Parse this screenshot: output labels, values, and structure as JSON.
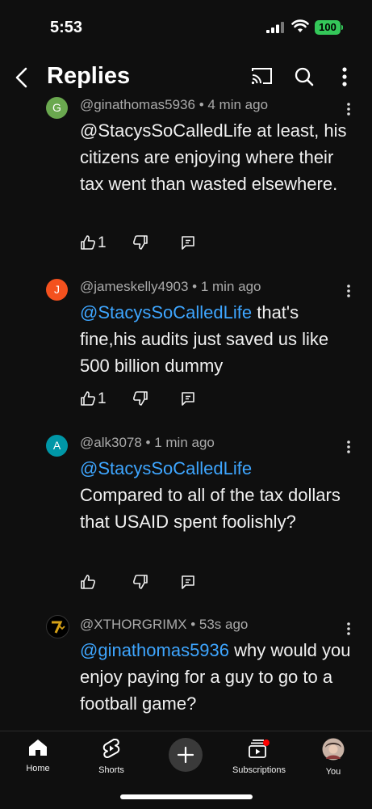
{
  "status_bar": {
    "time": "5:53",
    "battery": "100"
  },
  "header": {
    "title": "Replies"
  },
  "comments": [
    {
      "avatar_letter": "G",
      "avatar_color": "#6aa84f",
      "meta": "@ginathomas5936 • 4 min ago",
      "mention": "@StacysSoCalledLife",
      "text": " at least, his citizens are enjoying where their tax went than wasted elsewhere.",
      "likes": "1"
    },
    {
      "avatar_letter": "J",
      "avatar_color": "#f4511e",
      "meta": "@jameskelly4903 • 1 min ago",
      "mention": "@StacysSoCalledLife",
      "text": " that's fine,his audits just saved us like 500 billion dummy",
      "likes": "1"
    },
    {
      "avatar_letter": "A",
      "avatar_color": "#0097a7",
      "meta": "@alk3078 • 1 min ago",
      "mention": "@StacysSoCalledLife",
      "text": "Compared to all of the tax dollars that USAID spent foolishly?",
      "likes": ""
    },
    {
      "avatar_letter": "",
      "avatar_color": "#000000",
      "meta": "@XTHORGRIMX • 53s ago",
      "mention": "@ginathomas5936",
      "text": " why would you enjoy paying for a guy to go to a football game?",
      "likes": ""
    }
  ],
  "tabbar": {
    "home": "Home",
    "shorts": "Shorts",
    "subscriptions": "Subscriptions",
    "you": "You"
  },
  "colors": {
    "mention": "#3ea6ff",
    "background": "#0f0f0f",
    "notification_dot": "#ff0000"
  }
}
